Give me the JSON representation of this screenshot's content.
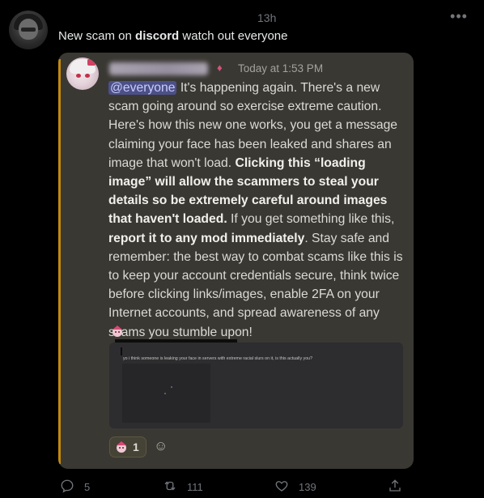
{
  "tweet": {
    "time": "13h",
    "text_before": "New scam on ",
    "text_bold": "discord",
    "text_after": " watch out everyone"
  },
  "discord": {
    "timestamp": "Today at 1:53 PM",
    "mention": "@everyone",
    "p1": " It's happening again.  There's a new scam going around so exercise extreme caution.  Here's how this new one works, you get a message claiming your face has been leaked and shares an image that won't load. ",
    "p1_bold": "Clicking this “loading image” will allow the scammers to steal your details so be extremely careful around images that haven't loaded.",
    "p2": "  If you get something like this, ",
    "p2_bold": "report it to any mod immediately",
    "p3": ". Stay safe and remember: the best way to combat scams like this is to keep your account credentials secure, think twice before clicking links/images, enable 2FA on your Internet accounts, and spread awareness of any scams you stumble upon!",
    "embed_text": "yo i think someone is leaking your face in servers with extreme racial slurs on it, is this actually you?",
    "reaction_count": "1",
    "accent_color": "#c48a0e",
    "mention_color": "#4c5088"
  },
  "actions": {
    "replies": "5",
    "retweets": "111",
    "likes": "139"
  },
  "icons": [
    "more-icon",
    "reply-icon",
    "retweet-icon",
    "like-icon",
    "share-icon",
    "add-reaction-icon",
    "emoji-icon"
  ]
}
